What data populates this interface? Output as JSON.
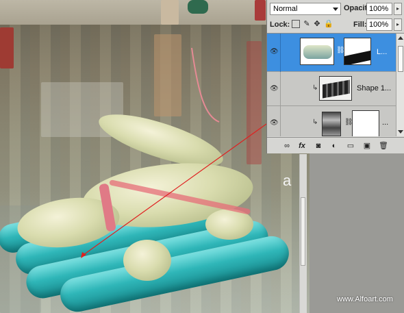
{
  "panel": {
    "blend_mode": "Normal",
    "opacity_label": "Opacity:",
    "opacity_value": "100%",
    "lock_label": "Lock:",
    "fill_label": "Fill:",
    "fill_value": "100%",
    "layers": [
      {
        "name": "L...",
        "selected": true,
        "has_mask": true,
        "clipped": false
      },
      {
        "name": "Shape 1...",
        "selected": false,
        "has_mask": false,
        "clipped": true
      },
      {
        "name": "...",
        "selected": false,
        "has_mask": true,
        "clipped": true
      }
    ],
    "footer_tools": [
      "link-icon",
      "fx-icon",
      "mask-icon",
      "adjustment-icon",
      "folder-icon",
      "new-layer-icon",
      "trash-icon"
    ]
  },
  "canvas": {
    "letter": "a",
    "credit": "www.Alfoart.com"
  },
  "colors": {
    "selection": "#3d8fe0",
    "link_line": "#e02020",
    "raft": "#2fb6b8"
  }
}
